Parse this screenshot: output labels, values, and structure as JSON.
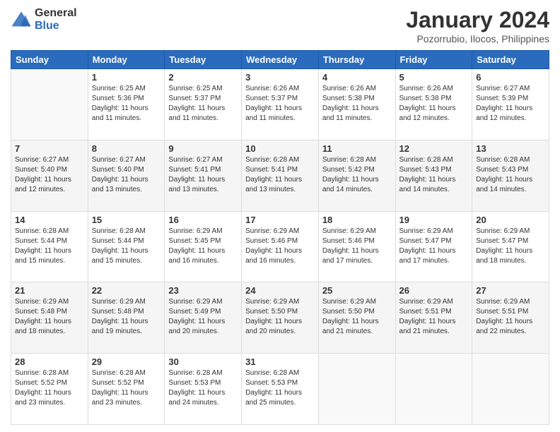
{
  "logo": {
    "general": "General",
    "blue": "Blue"
  },
  "header": {
    "month": "January 2024",
    "location": "Pozorrubio, Ilocos, Philippines"
  },
  "weekdays": [
    "Sunday",
    "Monday",
    "Tuesday",
    "Wednesday",
    "Thursday",
    "Friday",
    "Saturday"
  ],
  "weeks": [
    [
      {
        "day": "",
        "info": ""
      },
      {
        "day": "1",
        "info": "Sunrise: 6:25 AM\nSunset: 5:36 PM\nDaylight: 11 hours\nand 11 minutes."
      },
      {
        "day": "2",
        "info": "Sunrise: 6:25 AM\nSunset: 5:37 PM\nDaylight: 11 hours\nand 11 minutes."
      },
      {
        "day": "3",
        "info": "Sunrise: 6:26 AM\nSunset: 5:37 PM\nDaylight: 11 hours\nand 11 minutes."
      },
      {
        "day": "4",
        "info": "Sunrise: 6:26 AM\nSunset: 5:38 PM\nDaylight: 11 hours\nand 11 minutes."
      },
      {
        "day": "5",
        "info": "Sunrise: 6:26 AM\nSunset: 5:38 PM\nDaylight: 11 hours\nand 12 minutes."
      },
      {
        "day": "6",
        "info": "Sunrise: 6:27 AM\nSunset: 5:39 PM\nDaylight: 11 hours\nand 12 minutes."
      }
    ],
    [
      {
        "day": "7",
        "info": "Sunrise: 6:27 AM\nSunset: 5:40 PM\nDaylight: 11 hours\nand 12 minutes."
      },
      {
        "day": "8",
        "info": "Sunrise: 6:27 AM\nSunset: 5:40 PM\nDaylight: 11 hours\nand 13 minutes."
      },
      {
        "day": "9",
        "info": "Sunrise: 6:27 AM\nSunset: 5:41 PM\nDaylight: 11 hours\nand 13 minutes."
      },
      {
        "day": "10",
        "info": "Sunrise: 6:28 AM\nSunset: 5:41 PM\nDaylight: 11 hours\nand 13 minutes."
      },
      {
        "day": "11",
        "info": "Sunrise: 6:28 AM\nSunset: 5:42 PM\nDaylight: 11 hours\nand 14 minutes."
      },
      {
        "day": "12",
        "info": "Sunrise: 6:28 AM\nSunset: 5:43 PM\nDaylight: 11 hours\nand 14 minutes."
      },
      {
        "day": "13",
        "info": "Sunrise: 6:28 AM\nSunset: 5:43 PM\nDaylight: 11 hours\nand 14 minutes."
      }
    ],
    [
      {
        "day": "14",
        "info": "Sunrise: 6:28 AM\nSunset: 5:44 PM\nDaylight: 11 hours\nand 15 minutes."
      },
      {
        "day": "15",
        "info": "Sunrise: 6:28 AM\nSunset: 5:44 PM\nDaylight: 11 hours\nand 15 minutes."
      },
      {
        "day": "16",
        "info": "Sunrise: 6:29 AM\nSunset: 5:45 PM\nDaylight: 11 hours\nand 16 minutes."
      },
      {
        "day": "17",
        "info": "Sunrise: 6:29 AM\nSunset: 5:46 PM\nDaylight: 11 hours\nand 16 minutes."
      },
      {
        "day": "18",
        "info": "Sunrise: 6:29 AM\nSunset: 5:46 PM\nDaylight: 11 hours\nand 17 minutes."
      },
      {
        "day": "19",
        "info": "Sunrise: 6:29 AM\nSunset: 5:47 PM\nDaylight: 11 hours\nand 17 minutes."
      },
      {
        "day": "20",
        "info": "Sunrise: 6:29 AM\nSunset: 5:47 PM\nDaylight: 11 hours\nand 18 minutes."
      }
    ],
    [
      {
        "day": "21",
        "info": "Sunrise: 6:29 AM\nSunset: 5:48 PM\nDaylight: 11 hours\nand 18 minutes."
      },
      {
        "day": "22",
        "info": "Sunrise: 6:29 AM\nSunset: 5:48 PM\nDaylight: 11 hours\nand 19 minutes."
      },
      {
        "day": "23",
        "info": "Sunrise: 6:29 AM\nSunset: 5:49 PM\nDaylight: 11 hours\nand 20 minutes."
      },
      {
        "day": "24",
        "info": "Sunrise: 6:29 AM\nSunset: 5:50 PM\nDaylight: 11 hours\nand 20 minutes."
      },
      {
        "day": "25",
        "info": "Sunrise: 6:29 AM\nSunset: 5:50 PM\nDaylight: 11 hours\nand 21 minutes."
      },
      {
        "day": "26",
        "info": "Sunrise: 6:29 AM\nSunset: 5:51 PM\nDaylight: 11 hours\nand 21 minutes."
      },
      {
        "day": "27",
        "info": "Sunrise: 6:29 AM\nSunset: 5:51 PM\nDaylight: 11 hours\nand 22 minutes."
      }
    ],
    [
      {
        "day": "28",
        "info": "Sunrise: 6:28 AM\nSunset: 5:52 PM\nDaylight: 11 hours\nand 23 minutes."
      },
      {
        "day": "29",
        "info": "Sunrise: 6:28 AM\nSunset: 5:52 PM\nDaylight: 11 hours\nand 23 minutes."
      },
      {
        "day": "30",
        "info": "Sunrise: 6:28 AM\nSunset: 5:53 PM\nDaylight: 11 hours\nand 24 minutes."
      },
      {
        "day": "31",
        "info": "Sunrise: 6:28 AM\nSunset: 5:53 PM\nDaylight: 11 hours\nand 25 minutes."
      },
      {
        "day": "",
        "info": ""
      },
      {
        "day": "",
        "info": ""
      },
      {
        "day": "",
        "info": ""
      }
    ]
  ]
}
